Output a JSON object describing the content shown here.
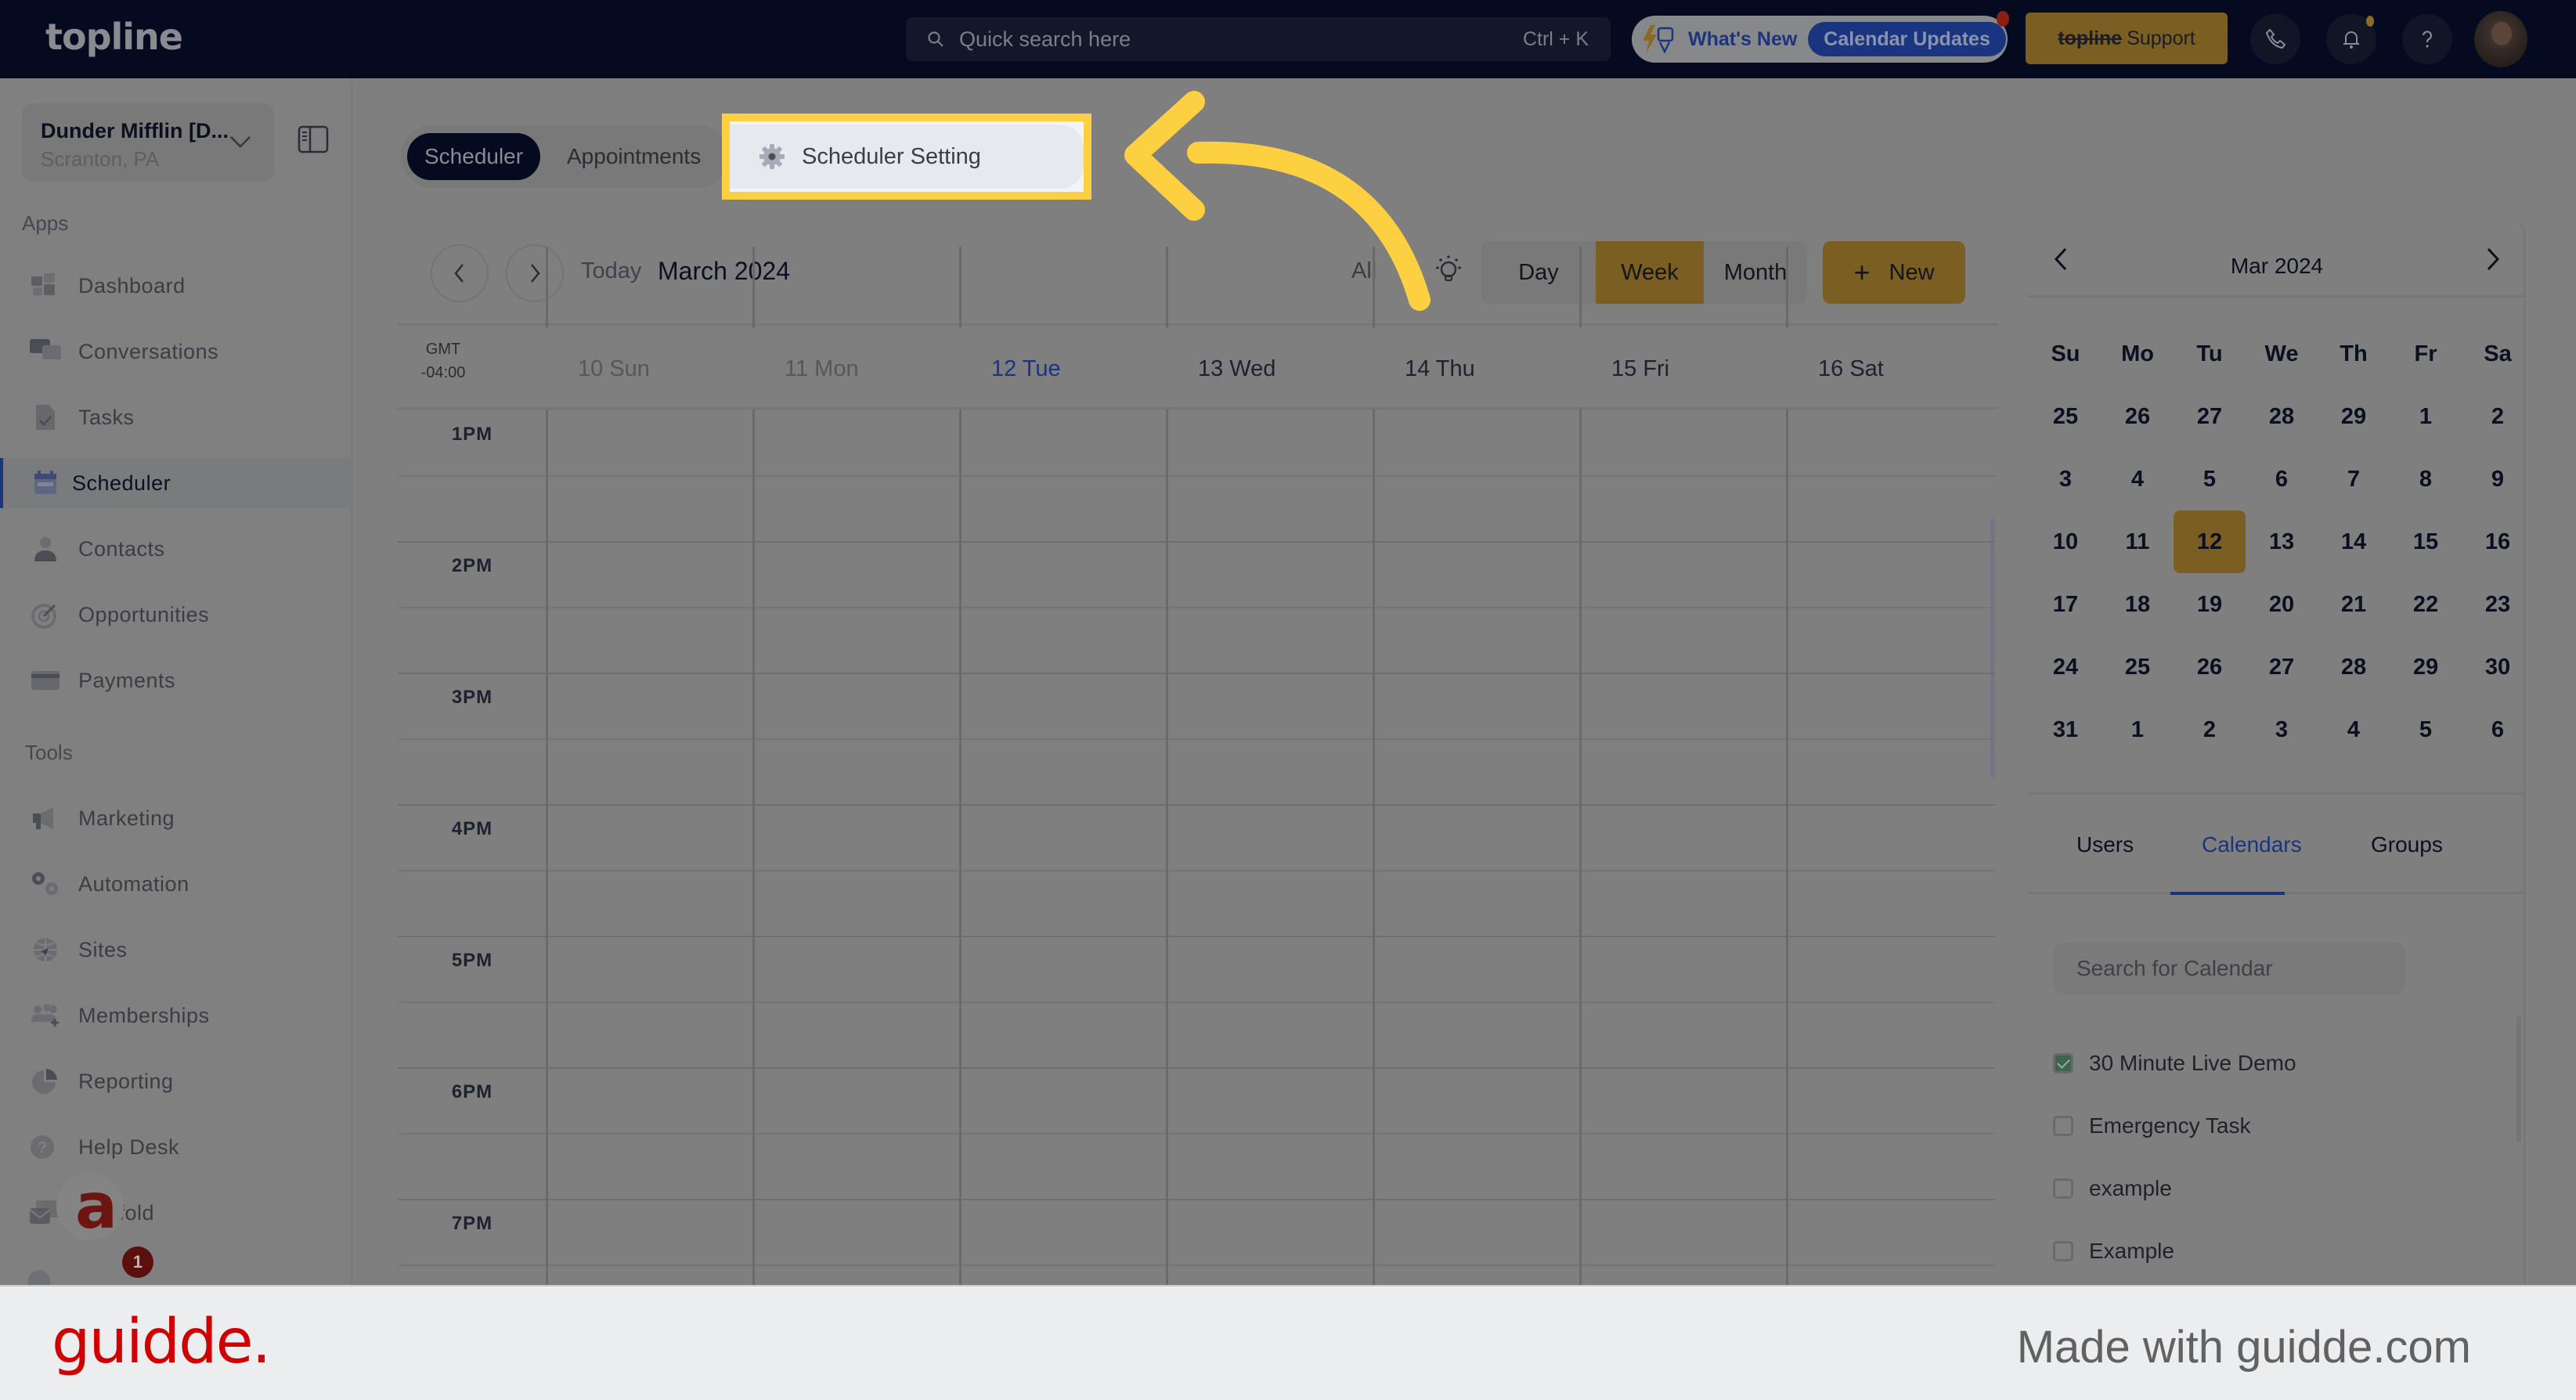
{
  "topbar": {
    "logo": "topline",
    "search_placeholder": "Quick search here",
    "search_shortcut": "Ctrl + K",
    "whats_new_label": "What's New",
    "calendar_updates_label": "Calendar Updates",
    "support_brand": "topline",
    "support_label": "Support"
  },
  "sidebar": {
    "account_name": "Dunder Mifflin [D...",
    "account_location": "Scranton, PA",
    "apps_label": "Apps",
    "apps": [
      {
        "label": "Dashboard",
        "icon": "dashboard-icon"
      },
      {
        "label": "Conversations",
        "icon": "chat-icon"
      },
      {
        "label": "Tasks",
        "icon": "task-icon"
      },
      {
        "label": "Scheduler",
        "icon": "calendar-icon",
        "active": true
      },
      {
        "label": "Contacts",
        "icon": "user-icon"
      },
      {
        "label": "Opportunities",
        "icon": "target-icon"
      },
      {
        "label": "Payments",
        "icon": "credit-card-icon"
      }
    ],
    "tools_label": "Tools",
    "tools": [
      {
        "label": "Marketing",
        "icon": "megaphone-icon"
      },
      {
        "label": "Automation",
        "icon": "gears-icon"
      },
      {
        "label": "Sites",
        "icon": "globe-icon"
      },
      {
        "label": "Memberships",
        "icon": "users-plus-icon"
      },
      {
        "label": "Reporting",
        "icon": "pie-chart-icon"
      },
      {
        "label": "Help Desk",
        "icon": "help-icon"
      },
      {
        "label": "Mailfold",
        "icon": "mail-icon"
      }
    ],
    "notification_count": "1"
  },
  "tabs": {
    "scheduler": "Scheduler",
    "appointments": "Appointments",
    "scheduler_setting": "Scheduler Setting"
  },
  "calendar": {
    "today_label": "Today",
    "month_title": "March 2024",
    "filter_label": "All",
    "views": [
      "Day",
      "Week",
      "Month"
    ],
    "active_view": "Week",
    "new_label": "New",
    "timezone_line1": "GMT",
    "timezone_line2": "-04:00",
    "days": [
      {
        "label": "10 Sun",
        "state": "past"
      },
      {
        "label": "11 Mon",
        "state": "past"
      },
      {
        "label": "12 Tue",
        "state": "today"
      },
      {
        "label": "13 Wed",
        "state": "future"
      },
      {
        "label": "14 Thu",
        "state": "future"
      },
      {
        "label": "15 Fri",
        "state": "future"
      },
      {
        "label": "16 Sat",
        "state": "future"
      }
    ],
    "hours": [
      "1PM",
      "2PM",
      "3PM",
      "4PM",
      "5PM",
      "6PM",
      "7PM"
    ]
  },
  "mini_calendar": {
    "title": "Mar 2024",
    "weekdays": [
      "Su",
      "Mo",
      "Tu",
      "We",
      "Th",
      "Fr",
      "Sa"
    ],
    "weeks": [
      [
        "25",
        "26",
        "27",
        "28",
        "29",
        "1",
        "2"
      ],
      [
        "3",
        "4",
        "5",
        "6",
        "7",
        "8",
        "9"
      ],
      [
        "10",
        "11",
        "12",
        "13",
        "14",
        "15",
        "16"
      ],
      [
        "17",
        "18",
        "19",
        "20",
        "21",
        "22",
        "23"
      ],
      [
        "24",
        "25",
        "26",
        "27",
        "28",
        "29",
        "30"
      ],
      [
        "31",
        "1",
        "2",
        "3",
        "4",
        "5",
        "6"
      ]
    ],
    "selected": "12"
  },
  "filter_panel": {
    "tabs": [
      "Users",
      "Calendars",
      "Groups"
    ],
    "active_tab": "Calendars",
    "search_placeholder": "Search for Calendar",
    "calendars": [
      {
        "label": "30 Minute Live Demo",
        "checked": true
      },
      {
        "label": "Emergency Task",
        "checked": false
      },
      {
        "label": "example",
        "checked": false
      },
      {
        "label": "Example",
        "checked": false
      }
    ]
  },
  "footer": {
    "brand": "guidde.",
    "made_with": "Made with guidde.com"
  },
  "colors": {
    "topbar_bg": "#040a1f",
    "accent_gold": "#7b5e21",
    "accent_blue": "#1a3480",
    "highlight_yellow": "#fdd041",
    "guidde_red": "#d10000"
  }
}
